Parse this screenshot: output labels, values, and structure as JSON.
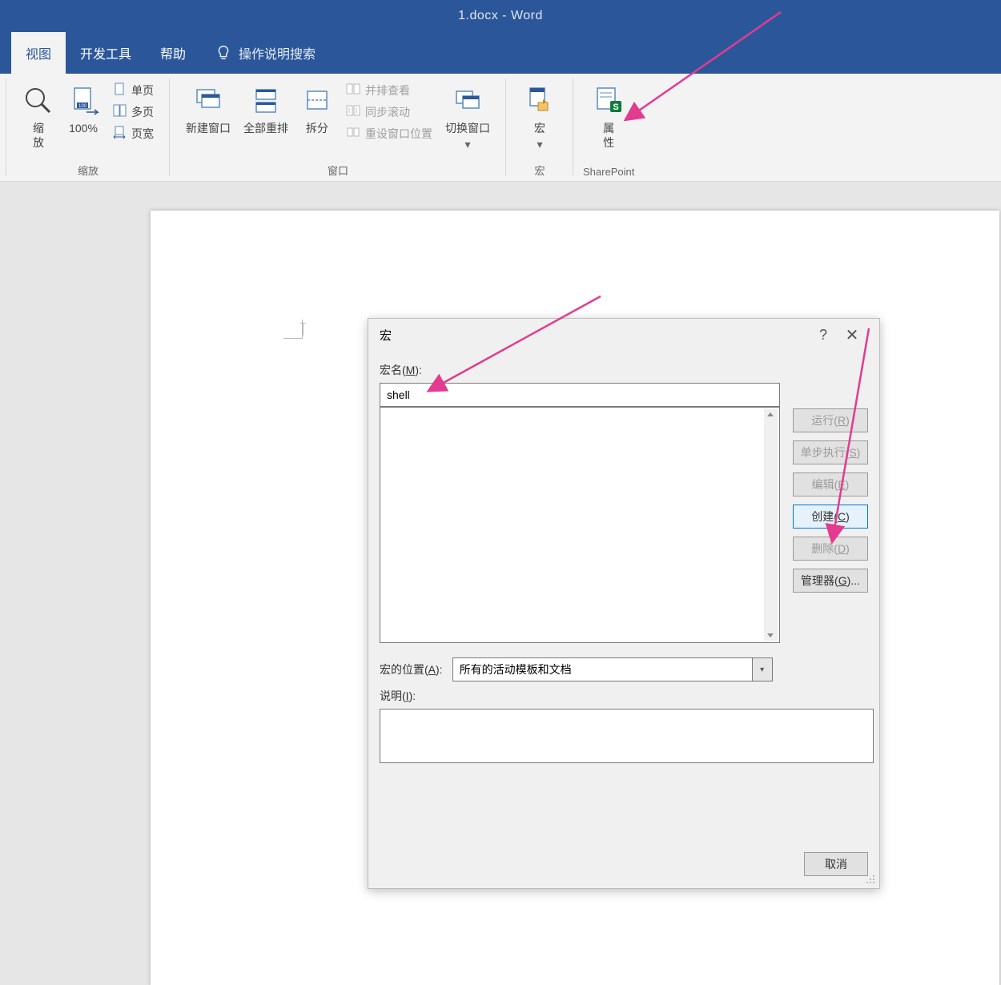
{
  "title": "1.docx  -  Word",
  "tabs": {
    "view": "视图",
    "dev": "开发工具",
    "help": "帮助",
    "tell": "操作说明搜索"
  },
  "ribbon": {
    "zoom": {
      "zoom": "缩\n放",
      "p100": "100%",
      "one": "单页",
      "multi": "多页",
      "width": "页宽",
      "label": "缩放"
    },
    "window": {
      "neww": "新建窗口",
      "arrange": "全部重排",
      "split": "拆分",
      "sidebyside": "并排查看",
      "sync": "同步滚动",
      "reset": "重设窗口位置",
      "switch": "切换窗口",
      "label": "窗口"
    },
    "macros": {
      "macros": "宏",
      "label": "宏"
    },
    "sp": {
      "prop": "属\n性",
      "label": "SharePoint"
    }
  },
  "dialog": {
    "title": "宏",
    "macro_name_label": "宏名(M):",
    "macro_name_value": "shell",
    "loc_label": "宏的位置(A):",
    "loc_value": "所有的活动模板和文档",
    "desc_label": "说明(I):",
    "help": "?",
    "close": "✕",
    "btn_run": "运行(R)",
    "btn_step": "单步执行(S)",
    "btn_edit": "编辑(E)",
    "btn_create": "创建(C)",
    "btn_delete": "删除(D)",
    "btn_organizer": "管理器(G)...",
    "btn_cancel": "取消"
  }
}
